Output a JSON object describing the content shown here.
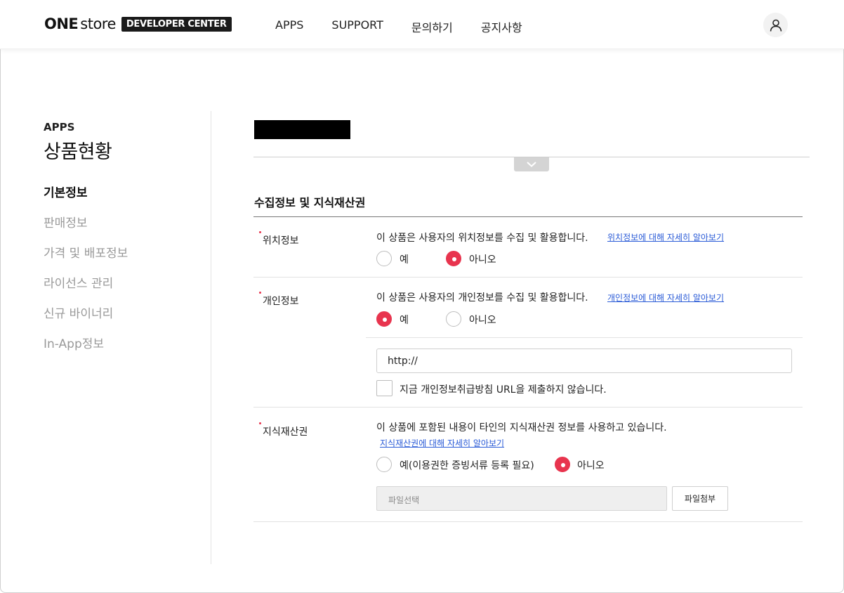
{
  "header": {
    "logo_one": "ONE",
    "logo_store": "store",
    "logo_badge": "DEVELOPER CENTER",
    "nav": [
      "APPS",
      "SUPPORT",
      "문의하기",
      "공지사항"
    ],
    "user_icon": "user-icon"
  },
  "sidebar": {
    "subtitle": "APPS",
    "title": "상품현황",
    "items": [
      {
        "label": "기본정보",
        "active": true
      },
      {
        "label": "판매정보",
        "active": false
      },
      {
        "label": "가격 및 배포정보",
        "active": false
      },
      {
        "label": "라이선스 관리",
        "active": false
      },
      {
        "label": "신규 바이너리",
        "active": false
      },
      {
        "label": "In-App정보",
        "active": false
      }
    ]
  },
  "section": {
    "title": "수집정보 및 지식재산권"
  },
  "location": {
    "label": "위치정보",
    "description": "이 상품은 사용자의 위치정보를 수집 및 활용합니다.",
    "link": "위치정보에 대해 자세히 알아보기",
    "option_yes": "예",
    "option_no": "아니오",
    "selected": "no"
  },
  "personal": {
    "label": "개인정보",
    "description": "이 상품은 사용자의 개인정보를 수집 및 활용합니다.",
    "link": "개인정보에 대해 자세히 알아보기",
    "option_yes": "예",
    "option_no": "아니오",
    "selected": "yes",
    "url_value": "http://",
    "checkbox_label": "지금 개인정보취급방침 URL을 제출하지 않습니다.",
    "checkbox_checked": false
  },
  "ip": {
    "label": "지식재산권",
    "description": "이 상품에 포함된 내용이 타인의 지식재산권 정보를 사용하고 있습니다.",
    "link": "지식재산권에 대해 자세히 알아보기",
    "option_yes": "예(이용권한 증빙서류 등록 필요)",
    "option_no": "아니오",
    "selected": "no",
    "file_placeholder": "파일선택",
    "file_button": "파일첨부"
  },
  "colors": {
    "accent": "#e8344e",
    "link": "#2a5bd7"
  }
}
